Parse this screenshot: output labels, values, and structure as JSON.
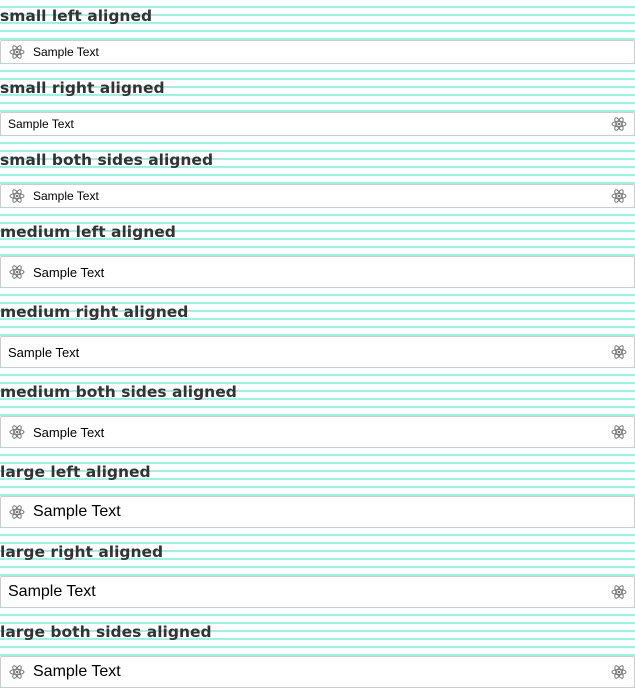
{
  "icon": "atom-icon",
  "colors": {
    "stripe": "#a8ece4",
    "border": "#cccccc",
    "heading": "#333333",
    "icon": "#777777"
  },
  "sections": [
    {
      "heading": "small left aligned",
      "value": "Sample Text"
    },
    {
      "heading": "small right aligned",
      "value": "Sample Text"
    },
    {
      "heading": "small both sides aligned",
      "value": "Sample Text"
    },
    {
      "heading": "medium left aligned",
      "value": "Sample Text"
    },
    {
      "heading": "medium right aligned",
      "value": "Sample Text"
    },
    {
      "heading": "medium both sides aligned",
      "value": "Sample Text"
    },
    {
      "heading": "large left aligned",
      "value": "Sample Text"
    },
    {
      "heading": "large right aligned",
      "value": "Sample Text"
    },
    {
      "heading": "large both sides aligned",
      "value": "Sample Text"
    }
  ]
}
